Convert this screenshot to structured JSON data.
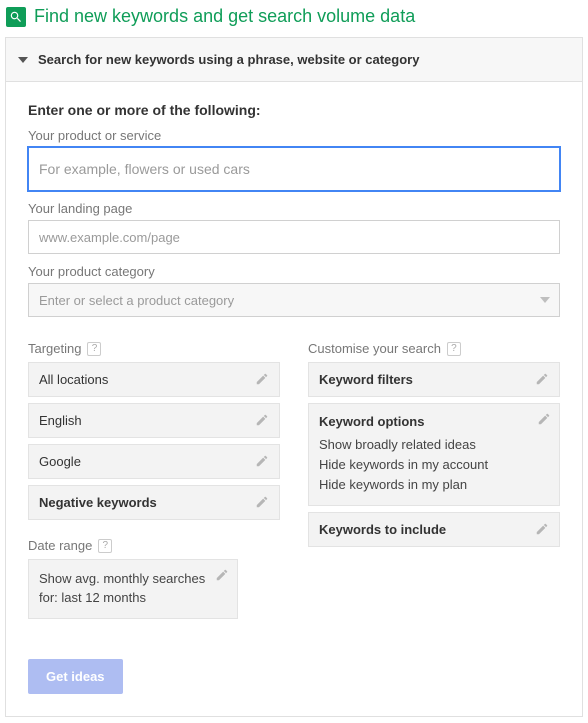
{
  "header": {
    "title": "Find new keywords and get search volume data"
  },
  "accordion": {
    "title": "Search for new keywords using a phrase, website or category"
  },
  "intro_label": "Enter one or more of the following:",
  "fields": {
    "product_label": "Your product or service",
    "product_placeholder": "For example, flowers or used cars",
    "landing_label": "Your landing page",
    "landing_placeholder": "www.example.com/page",
    "category_label": "Your product category",
    "category_placeholder": "Enter or select a product category"
  },
  "targeting": {
    "label": "Targeting",
    "items": [
      {
        "label": "All locations",
        "bold": false
      },
      {
        "label": "English",
        "bold": false
      },
      {
        "label": "Google",
        "bold": false
      },
      {
        "label": "Negative keywords",
        "bold": true
      }
    ]
  },
  "date_range": {
    "label": "Date range",
    "text": "Show avg. monthly searches for: last 12 months"
  },
  "customise": {
    "label": "Customise your search",
    "keyword_filters": "Keyword filters",
    "keyword_options": {
      "title": "Keyword options",
      "lines": [
        "Show broadly related ideas",
        "Hide keywords in my account",
        "Hide keywords in my plan"
      ]
    },
    "keywords_to_include": "Keywords to include"
  },
  "submit": {
    "label": "Get ideas"
  }
}
